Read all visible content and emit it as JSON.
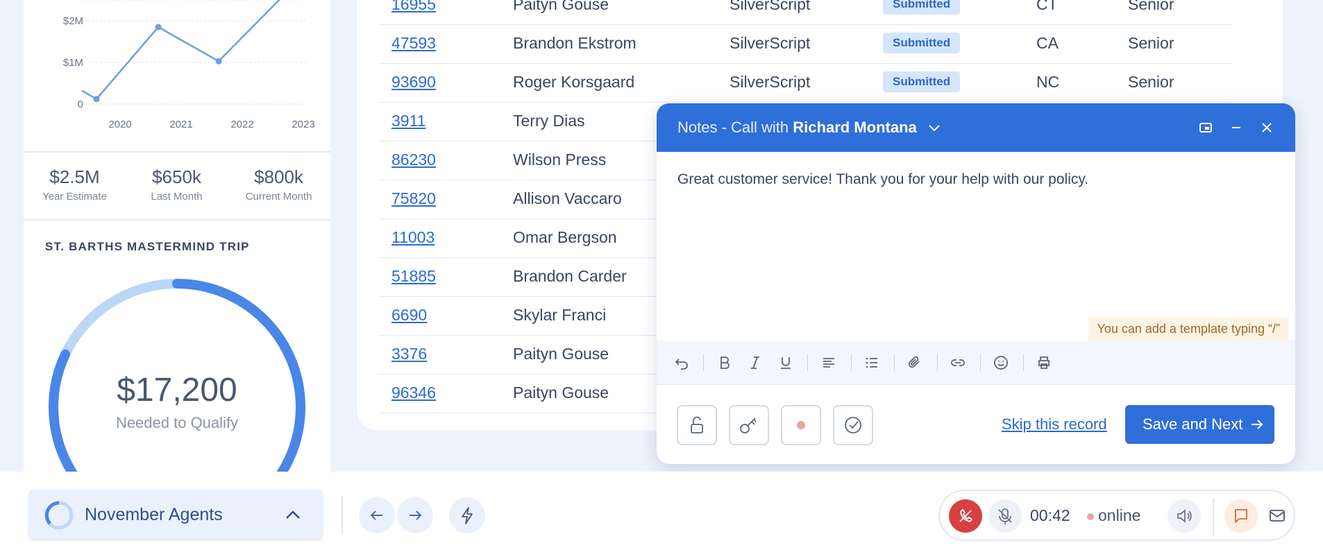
{
  "chart_data": {
    "type": "line",
    "x": [
      2020,
      2021,
      2022,
      2023
    ],
    "y_ticks": [
      "0",
      "$1M",
      "$2M"
    ],
    "x_ticks": [
      "2020",
      "2021",
      "2022",
      "2023"
    ],
    "values_millions": [
      0.2,
      2.2,
      1.25,
      2.7
    ],
    "xlabel": "",
    "ylabel": "",
    "ylim": [
      0,
      2.5
    ],
    "grid": true,
    "color": "#6c9fe0"
  },
  "stats": [
    {
      "value": "$2.5M",
      "label": "Year Estimate"
    },
    {
      "value": "$650k",
      "label": "Last Month"
    },
    {
      "value": "$800k",
      "label": "Current Month"
    }
  ],
  "trip": {
    "title": "ST. BARTHS MASTERMIND TRIP",
    "amount": "$17,200",
    "label": "Needed to Qualify",
    "progress": 0.82,
    "ring_color": "#4a86e8",
    "ring_track_color": "#bcd6f6"
  },
  "table": {
    "rows": [
      {
        "id": "16955",
        "name": "Paityn Gouse",
        "plan": "SilverScript",
        "status": "Submitted",
        "state": "CT",
        "type": "Senior"
      },
      {
        "id": "47593",
        "name": "Brandon Ekstrom",
        "plan": "SilverScript",
        "status": "Submitted",
        "state": "CA",
        "type": "Senior"
      },
      {
        "id": "93690",
        "name": "Roger Korsgaard",
        "plan": "SilverScript",
        "status": "Submitted",
        "state": "NC",
        "type": "Senior"
      },
      {
        "id": "3911",
        "name": "Terry Dias"
      },
      {
        "id": "86230",
        "name": "Wilson Press"
      },
      {
        "id": "75820",
        "name": "Allison Vaccaro"
      },
      {
        "id": "11003",
        "name": "Omar Bergson"
      },
      {
        "id": "51885",
        "name": "Brandon Carder"
      },
      {
        "id": "6690",
        "name": "Skylar Franci"
      },
      {
        "id": "3376",
        "name": "Paityn Gouse"
      },
      {
        "id": "96346",
        "name": "Paityn Gouse"
      }
    ]
  },
  "notes": {
    "title_prefix": "Notes - Call with ",
    "contact": "Richard Montana",
    "body": "Great customer service! Thank you for your help with our policy.",
    "template_hint": "You can add a template typing “/”",
    "skip_label": "Skip this record",
    "save_label": "Save and Next",
    "accent": "#2f6fd9"
  },
  "bottom_bar": {
    "campaign": "November Agents",
    "timer": "00:42",
    "status": "online"
  }
}
